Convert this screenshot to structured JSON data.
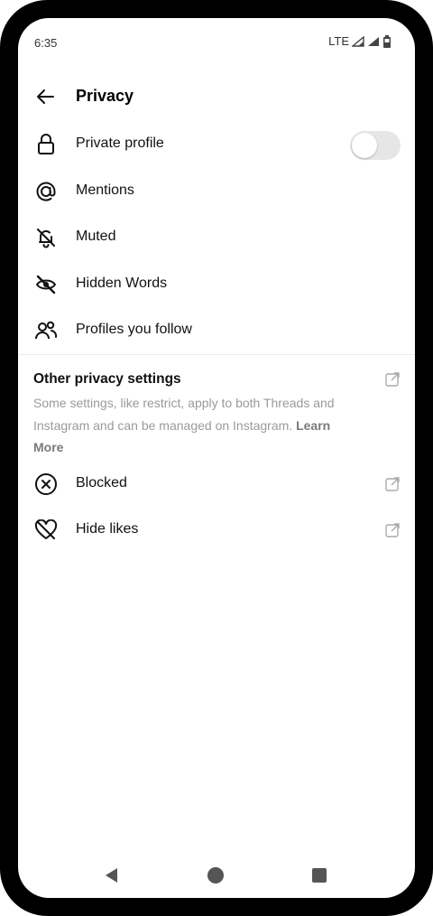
{
  "status_bar": {
    "time": "6:35",
    "network": "LTE"
  },
  "header": {
    "title": "Privacy"
  },
  "menu": [
    {
      "label": "Private profile",
      "icon": "lock-icon",
      "toggle": false
    },
    {
      "label": "Mentions",
      "icon": "threads-at-icon"
    },
    {
      "label": "Muted",
      "icon": "bell-off-icon"
    },
    {
      "label": "Hidden Words",
      "icon": "eye-off-icon"
    },
    {
      "label": "Profiles you follow",
      "icon": "people-icon"
    }
  ],
  "other": {
    "heading": "Other privacy settings",
    "description": "Some settings, like restrict, apply to both Threads and Instagram and can be managed on Instagram.",
    "learn_more": "Learn More",
    "items": [
      {
        "label": "Blocked",
        "icon": "blocked-icon"
      },
      {
        "label": "Hide likes",
        "icon": "heart-off-icon"
      }
    ]
  },
  "colors": {
    "text": "#111111",
    "muted_text": "#9a9a9a",
    "toggle_off": "#e6e6e6"
  }
}
